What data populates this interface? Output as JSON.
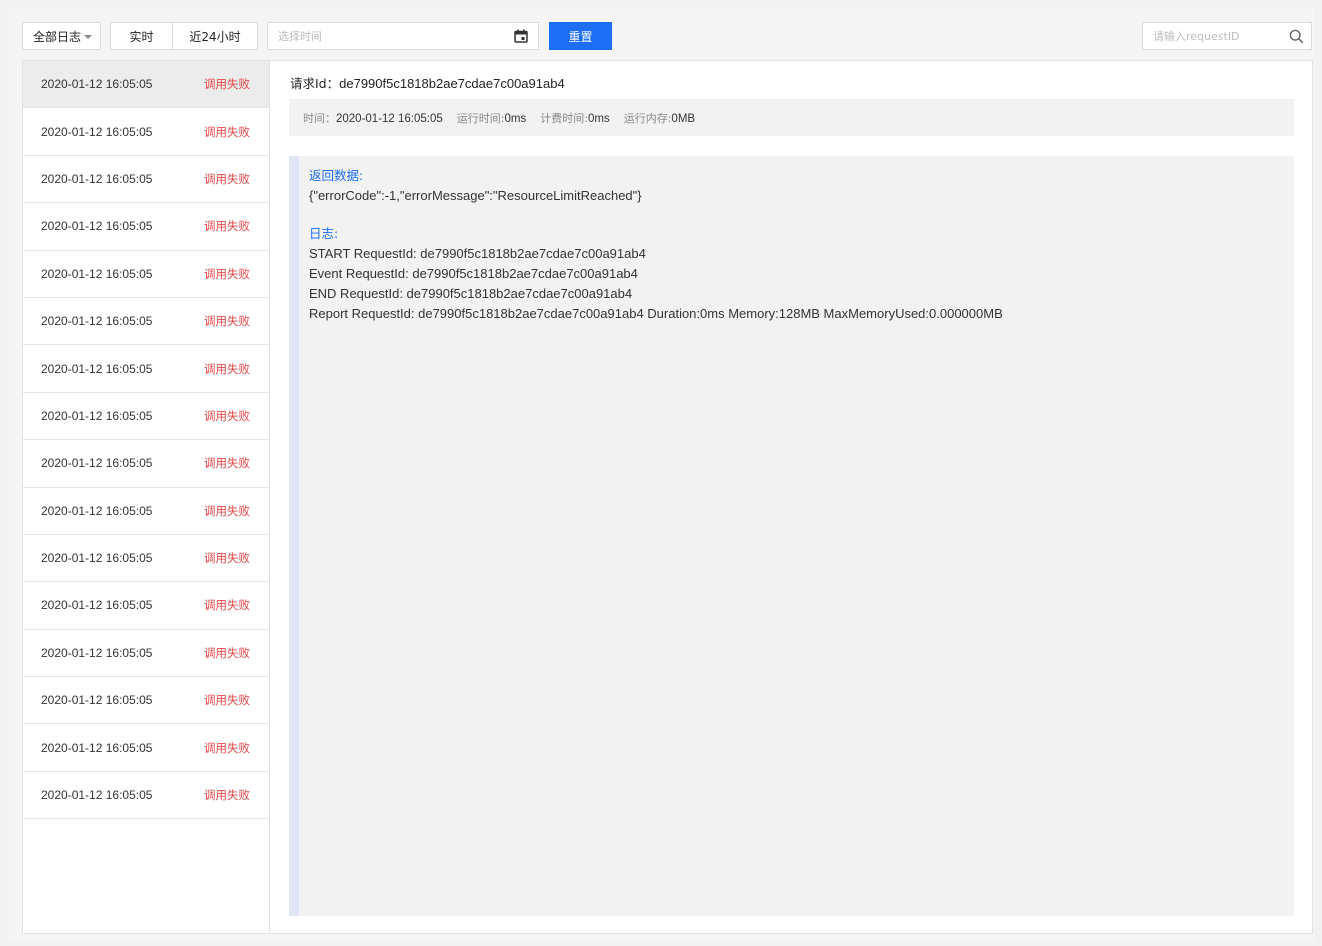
{
  "toolbar": {
    "log_filter": "全部日志",
    "realtime_label": "实时",
    "last24h_label": "近24小时",
    "date_placeholder": "选择时间",
    "reset_label": "重置",
    "search_placeholder": "请输入requestID"
  },
  "log_list": [
    {
      "time": "2020-01-12 16:05:05",
      "status": "调用失败"
    },
    {
      "time": "2020-01-12 16:05:05",
      "status": "调用失败"
    },
    {
      "time": "2020-01-12 16:05:05",
      "status": "调用失败"
    },
    {
      "time": "2020-01-12 16:05:05",
      "status": "调用失败"
    },
    {
      "time": "2020-01-12 16:05:05",
      "status": "调用失败"
    },
    {
      "time": "2020-01-12 16:05:05",
      "status": "调用失败"
    },
    {
      "time": "2020-01-12 16:05:05",
      "status": "调用失败"
    },
    {
      "time": "2020-01-12 16:05:05",
      "status": "调用失败"
    },
    {
      "time": "2020-01-12 16:05:05",
      "status": "调用失败"
    },
    {
      "time": "2020-01-12 16:05:05",
      "status": "调用失败"
    },
    {
      "time": "2020-01-12 16:05:05",
      "status": "调用失败"
    },
    {
      "time": "2020-01-12 16:05:05",
      "status": "调用失败"
    },
    {
      "time": "2020-01-12 16:05:05",
      "status": "调用失败"
    },
    {
      "time": "2020-01-12 16:05:05",
      "status": "调用失败"
    },
    {
      "time": "2020-01-12 16:05:05",
      "status": "调用失败"
    },
    {
      "time": "2020-01-12 16:05:05",
      "status": "调用失败"
    }
  ],
  "detail": {
    "request_label": "请求Id：",
    "request_id": "de7990f5c1818b2ae7cdae7c00a91ab4",
    "meta": {
      "time_label": "时间：",
      "time_value": "2020-01-12 16:05:05",
      "run_time_label": "运行时间:",
      "run_time_value": "0ms",
      "billed_time_label": "计费时间:",
      "billed_time_value": "0ms",
      "memory_label": "运行内存:",
      "memory_value": "0MB"
    },
    "return_label": "返回数据:",
    "return_value": "{\"errorCode\":-1,\"errorMessage\":\"ResourceLimitReached\"}",
    "log_label": "日志:",
    "log_lines": [
      "START RequestId: de7990f5c1818b2ae7cdae7c00a91ab4",
      "Event RequestId: de7990f5c1818b2ae7cdae7c00a91ab4",
      "END RequestId: de7990f5c1818b2ae7cdae7c00a91ab4",
      "Report RequestId: de7990f5c1818b2ae7cdae7c00a91ab4 Duration:0ms Memory:128MB MaxMemoryUsed:0.000000MB"
    ]
  },
  "colors": {
    "accent": "#1d6ef5",
    "error": "#e54545"
  }
}
